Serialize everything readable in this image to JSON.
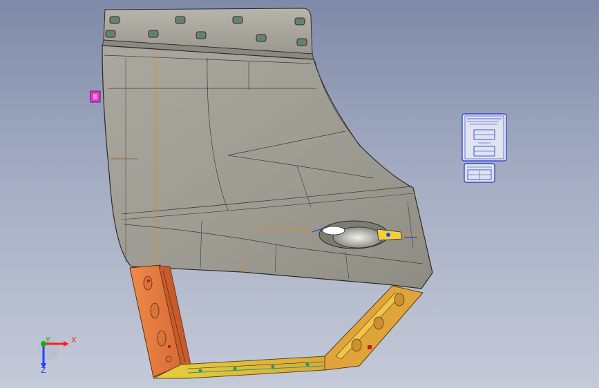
{
  "viewport": {
    "background_top": "#7f8aa8",
    "background_bottom": "#c4cad8"
  },
  "model": {
    "description_color_panel": "#5e5e5a",
    "panel_fill": "#9d9b91",
    "frame_color": "#e0874a",
    "sill_color": "#d8c23a"
  },
  "axis_triad": {
    "x_label": "X",
    "y_label": "Y",
    "z_label": "Z",
    "x_color": "#ff2020",
    "y_color": "#10b010",
    "z_color": "#2040ff"
  },
  "drawing_sheets": {
    "border_color": "#2233cc"
  }
}
